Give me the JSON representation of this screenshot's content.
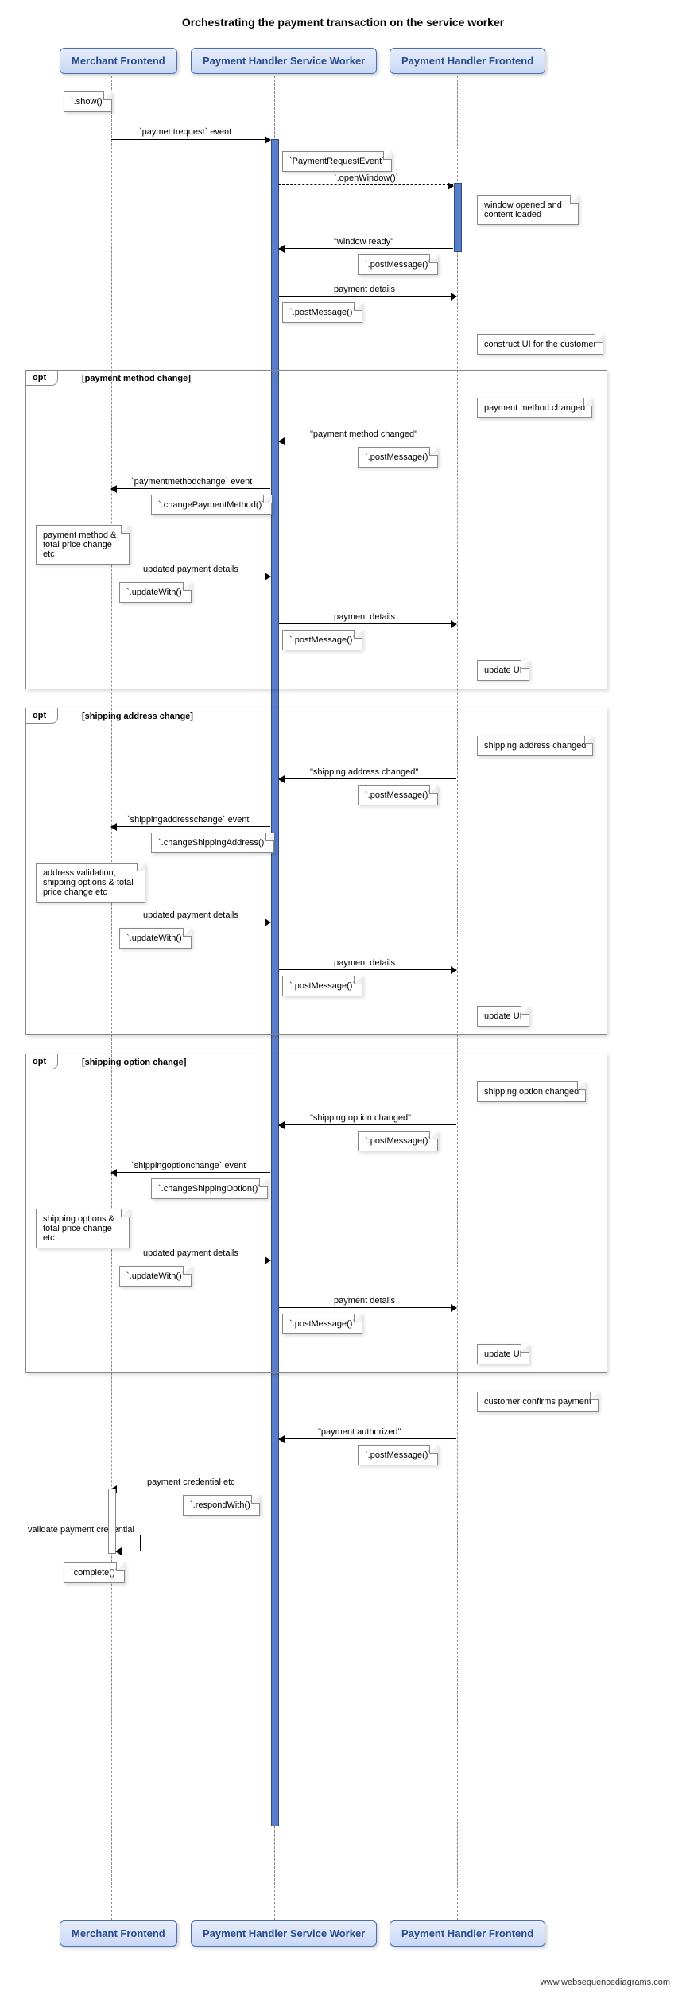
{
  "title": "Orchestrating the payment transaction on the service worker",
  "actors": {
    "merchant": "Merchant Frontend",
    "worker": "Payment Handler Service Worker",
    "handler": "Payment Handler Frontend"
  },
  "messages": {
    "show": "`.show()`",
    "payreq_event": "`paymentrequest` event",
    "pre": "`PaymentRequestEvent`",
    "openwin": "`.openWindow()`",
    "win_loaded": "window opened and content loaded",
    "win_ready": "\"window ready\"",
    "post": "`.postMessage()`",
    "pay_details": "payment details",
    "construct_ui": "construct UI for the customer",
    "opt_pmc": "[payment method change]",
    "pmc_act": "payment method changed",
    "pmc_msg": "\"payment method changed\"",
    "pmc_event": "`paymentmethodchange` event",
    "cpm": "`.changePaymentMethod()`",
    "pmc_note": "payment method & total price change etc",
    "upd_details": "updated payment details",
    "updwith": "`.updateWith()`",
    "update_ui": "update UI",
    "opt_sac": "[shipping address change]",
    "sac_act": "shipping address changed",
    "sac_msg": "\"shipping address changed\"",
    "sac_event": "`shippingaddresschange` event",
    "csa": "`.changeShippingAddress()`",
    "sac_note": "address validation, shipping options & total price change etc",
    "opt_soc": "[shipping option change]",
    "soc_act": "shipping option changed",
    "soc_msg": "\"shipping option changed\"",
    "soc_event": "`shippingoptionchange` event",
    "cso": "`.changeShippingOption()`",
    "soc_note": "shipping options & total price change etc",
    "confirm": "customer confirms payment",
    "pay_auth": "\"payment authorized\"",
    "pay_cred": "payment credential etc",
    "respond": "`.respondWith()`",
    "validate": "validate payment credential",
    "complete": "`complete()`"
  },
  "labels": {
    "opt": "opt"
  },
  "credit": "www.websequencediagrams.com"
}
